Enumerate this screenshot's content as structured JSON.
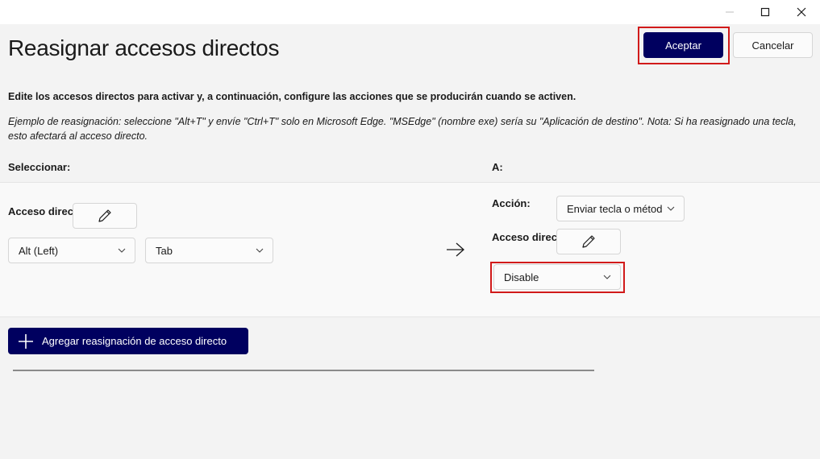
{
  "window": {
    "controls": [
      "minimize",
      "maximize",
      "close"
    ]
  },
  "page": {
    "title": "Reasignar accesos directos",
    "accept_label": "Aceptar",
    "cancel_label": "Cancelar",
    "description": "Edite los accesos directos para activar y, a continuación, configure las acciones que se producirán cuando se activen.",
    "example": "Ejemplo de reasignación: seleccione \"Alt+T\" y envíe \"Ctrl+T\" solo en Microsoft Edge. \"MSEdge\" (nombre exe) sería su \"Aplicación de destino\". Nota: Si ha reasignado una tecla, esto afectará al acceso directo.",
    "select_header": "Seleccionar:",
    "to_header": "A:"
  },
  "source": {
    "shortcut_label": "Acceso directo:",
    "key1": "Alt (Left)",
    "key2": "Tab"
  },
  "target": {
    "action_label": "Acción:",
    "action_value": "Enviar tecla o métod",
    "shortcut_label": "Acceso directo:",
    "key_value": "Disable"
  },
  "add_button_label": "Agregar reasignación de acceso directo",
  "colors": {
    "accent": "#00005f",
    "highlight": "#d11a1a",
    "background": "#f3f3f3"
  },
  "icons": {
    "edit": "pencil-icon",
    "dropdown": "chevron-down-icon",
    "arrow": "arrow-right-icon",
    "add": "plus-icon"
  }
}
